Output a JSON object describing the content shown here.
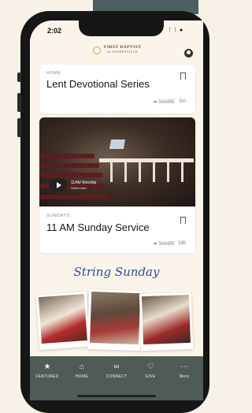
{
  "status": {
    "time": "2:02"
  },
  "header": {
    "church_line1": "FIRST BAPTIST",
    "church_line2": "of GAINESVILLE"
  },
  "cards": [
    {
      "tag": "HOME",
      "title": "Lent Devotional Series",
      "share": "SHARE",
      "age": "5m"
    },
    {
      "tag": "SUNDAYS",
      "title": "11 AM Sunday Service",
      "share": "SHARE",
      "age": "18h",
      "video_title": "11AM Worship",
      "video_subtitle": "Watch later"
    }
  ],
  "promo": {
    "title": "String Sunday"
  },
  "tabbar": [
    {
      "label": "FEATURED",
      "icon": "star-icon"
    },
    {
      "label": "HOME",
      "icon": "home-icon"
    },
    {
      "label": "CONNECT",
      "icon": "link-icon"
    },
    {
      "label": "GIVE",
      "icon": "heart-icon"
    },
    {
      "label": "More",
      "icon": "more-icon"
    }
  ]
}
